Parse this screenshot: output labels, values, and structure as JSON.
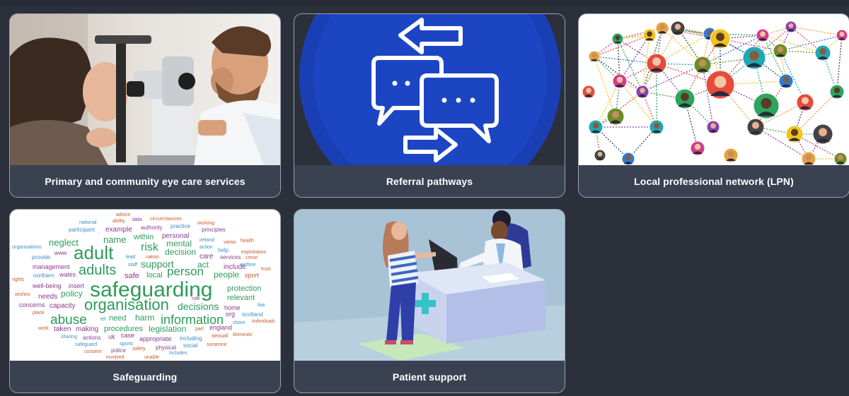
{
  "cards": [
    {
      "title": "Primary and community eye care services",
      "image": "eye-examination-photo"
    },
    {
      "title": "Referral pathways",
      "image": "referral-arrows-speech-bubbles-icon"
    },
    {
      "title": "Local professional network (LPN)",
      "image": "people-network-illustration"
    },
    {
      "title": "Safeguarding",
      "image": "safeguarding-word-cloud"
    },
    {
      "title": "Patient support",
      "image": "patient-at-reception-desk-illustration"
    }
  ],
  "wordcloud": {
    "w1": "advice",
    "w2": "national",
    "w3": "ability",
    "w4": "data",
    "w5": "circumstances",
    "w6": "working",
    "w7": "participant",
    "w8": "example",
    "w9": "authority",
    "w10": "practice",
    "w11": "principles",
    "w12": "organisations",
    "w13": "neglect",
    "w14": "name",
    "w15": "within",
    "w16": "personal",
    "w17": "ireland",
    "w18": "views",
    "w19": "health",
    "w20": "provide",
    "w21": "www",
    "w22": "adult",
    "w23": "risk",
    "w24": "mental",
    "w25": "action",
    "w26": "lead",
    "w27": "nation",
    "w28": "decision",
    "w29": "help",
    "w30": "exploitation",
    "w31": "management",
    "w32": "staff",
    "w33": "support",
    "w34": "care",
    "w35": "services",
    "w36": "crime",
    "w37": "rights",
    "w38": "northern",
    "w39": "wales",
    "w40": "adults",
    "w41": "act",
    "w42": "include",
    "w43": "welfore",
    "w44": "trust",
    "w45": "safe",
    "w46": "local",
    "w47": "person",
    "w48": "people",
    "w49": "sport",
    "w50": "well-being",
    "w51": "insert",
    "w52": "safeguarding",
    "w53": "protection",
    "w54": "wishes",
    "w55": "needs",
    "w56": "policy",
    "w57": "role",
    "w58": "relevant",
    "w59": "concerns",
    "w60": "capacity",
    "w61": "organisation",
    "w62": "decisions",
    "w63": "home",
    "w64": "law",
    "w65": "place",
    "w66": "abuse",
    "w67": "tel",
    "w68": "need",
    "w69": "harm",
    "w70": "information",
    "w71": "org",
    "w72": "scotland",
    "w73": "share",
    "w74": "individuals",
    "w75": "work",
    "w76": "taken",
    "w77": "making",
    "w78": "procedures",
    "w79": "legislation",
    "w80": "part",
    "w81": "england",
    "w82": "sharing",
    "w83": "actions",
    "w84": "uk",
    "w85": "case",
    "w86": "appropriate",
    "w87": "including",
    "w88": "sexual",
    "w89": "domestic",
    "w90": "safeguard",
    "w91": "sports",
    "w92": "physical",
    "w93": "social",
    "w94": "someone",
    "w95": "consent",
    "w96": "police",
    "w97": "safety",
    "w98": "includes",
    "w99": "involved",
    "w100": "unable"
  }
}
